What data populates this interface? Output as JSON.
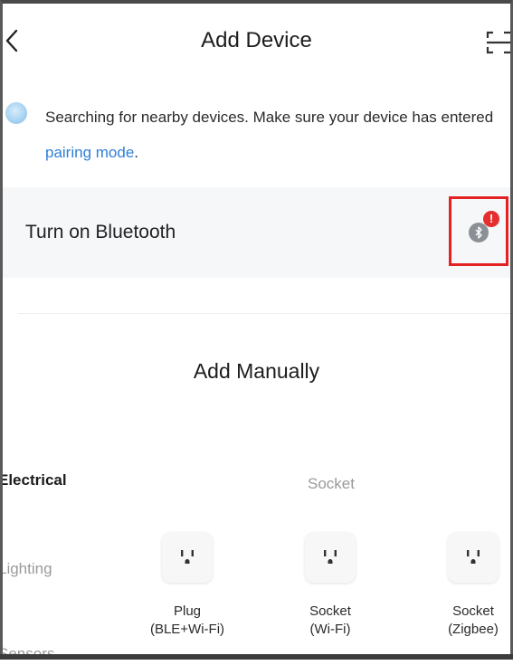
{
  "header": {
    "title": "Add Device",
    "back_icon": "chevron-left-icon",
    "scan_icon": "scan-icon"
  },
  "search": {
    "text_before": "Searching for nearby devices. Make sure your device has entered ",
    "link_text": "pairing mode",
    "text_after": "."
  },
  "bluetooth": {
    "label": "Turn on Bluetooth",
    "icon": "bluetooth-icon",
    "alert": "!"
  },
  "manual": {
    "title": "Add Manually"
  },
  "categories": [
    {
      "label": "Electrical",
      "active": true
    },
    {
      "label": "Lighting",
      "active": false
    },
    {
      "label": "Sensors",
      "active": false
    }
  ],
  "section": {
    "label": "Socket"
  },
  "devices": [
    {
      "line1": "Plug",
      "line2": "(BLE+Wi-Fi)"
    },
    {
      "line1": "Socket",
      "line2": "(Wi-Fi)"
    },
    {
      "line1": "Socket",
      "line2": "(Zigbee)"
    }
  ],
  "colors": {
    "link": "#2e7fd6",
    "alert": "#e52e2e",
    "highlight": "#e52222",
    "row_bg": "#f5f7f9"
  }
}
